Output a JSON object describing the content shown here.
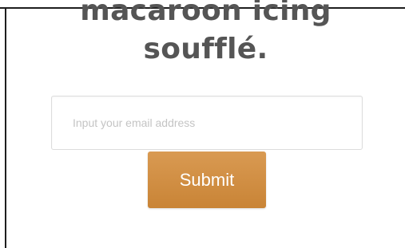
{
  "hero": {
    "heading_line1": "macaroon icing",
    "heading_line2": "soufflé."
  },
  "signup": {
    "email_placeholder": "Input your email address",
    "email_value": "",
    "submit_label": "Submit"
  },
  "colors": {
    "button": "#cf8c40",
    "heading_text": "#555555",
    "frame_line": "#1e1e1e"
  }
}
